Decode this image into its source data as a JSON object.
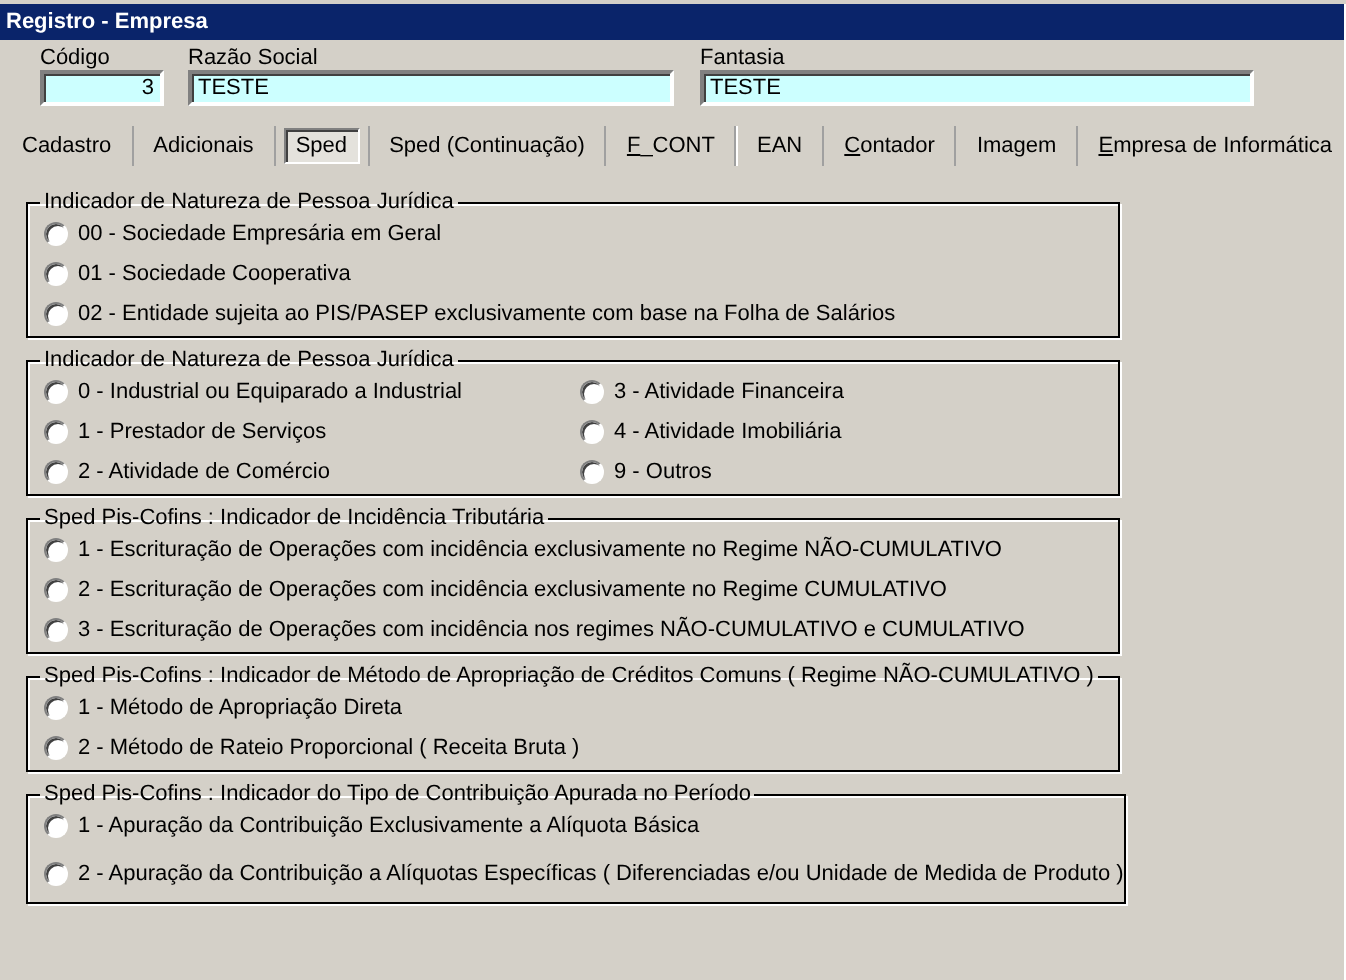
{
  "window": {
    "title": "Registro - Empresa"
  },
  "fields": [
    {
      "label": "Código",
      "value": "3"
    },
    {
      "label": "Razão Social",
      "value": "TESTE"
    },
    {
      "label": "Fantasia",
      "value": "TESTE"
    }
  ],
  "tabs": [
    {
      "label": "Cadastro",
      "selected": false,
      "hotkey": false
    },
    {
      "label": "Adicionais",
      "selected": false,
      "hotkey": false
    },
    {
      "label": "Sped",
      "selected": true,
      "hotkey": false
    },
    {
      "label": "Sped (Continuação)",
      "selected": false,
      "hotkey": false
    },
    {
      "label": "F_CONT",
      "selected": false,
      "hotkey": true
    },
    {
      "label": "EAN",
      "selected": false,
      "hotkey": false
    },
    {
      "label": "Contador",
      "selected": false,
      "hotkey": true
    },
    {
      "label": "Imagem",
      "selected": false,
      "hotkey": false
    },
    {
      "label": "Empresa de Informática",
      "selected": false,
      "hotkey": true
    }
  ],
  "groups": [
    {
      "title": "Indicador de Natureza de Pessoa Jurídica",
      "columns": [
        [
          {
            "label": "00 - Sociedade Empresária em Geral",
            "selected": false
          },
          {
            "label": "01 - Sociedade Cooperativa",
            "selected": false
          },
          {
            "label": "02 - Entidade sujeita ao PIS/PASEP exclusivamente com base na Folha de Salários",
            "selected": false
          }
        ]
      ]
    },
    {
      "title": "Indicador de Natureza de Pessoa Jurídica",
      "columns": [
        [
          {
            "label": "0 - Industrial ou Equiparado a Industrial",
            "selected": false
          },
          {
            "label": "1 - Prestador de Serviços",
            "selected": false
          },
          {
            "label": "2 - Atividade de Comércio",
            "selected": false
          }
        ],
        [
          {
            "label": "3 - Atividade Financeira",
            "selected": false
          },
          {
            "label": "4 - Atividade Imobiliária",
            "selected": false
          },
          {
            "label": "9 - Outros",
            "selected": false
          }
        ]
      ]
    },
    {
      "title": "Sped Pis-Cofins : Indicador de Incidência Tributária",
      "columns": [
        [
          {
            "label": "1 - Escrituração de Operações com incidência exclusivamente no Regime NÃO-CUMULATIVO",
            "selected": false
          },
          {
            "label": "2 - Escrituração de Operações com incidência exclusivamente no Regime CUMULATIVO",
            "selected": false
          },
          {
            "label": "3 - Escrituração de Operações com incidência nos regimes NÃO-CUMULATIVO e CUMULATIVO",
            "selected": false
          }
        ]
      ]
    },
    {
      "title": "Sped Pis-Cofins : Indicador de Método de Apropriação de Créditos Comuns  ( Regime NÃO-CUMULATIVO )",
      "columns": [
        [
          {
            "label": "1 - Método de Apropriação Direta",
            "selected": false
          },
          {
            "label": "2 - Método de Rateio Proporcional ( Receita Bruta )",
            "selected": false
          }
        ]
      ]
    },
    {
      "title": "Sped Pis-Cofins : Indicador do Tipo de Contribuição Apurada no Período",
      "columns": [
        [
          {
            "label": "1 - Apuração da Contribuição Exclusivamente a Alíquota Básica",
            "selected": false
          },
          {
            "label": "2 - Apuração da Contribuição a Alíquotas Específicas ( Diferenciadas e/ou Unidade de Medida de Produto )",
            "selected": false
          }
        ]
      ]
    }
  ]
}
